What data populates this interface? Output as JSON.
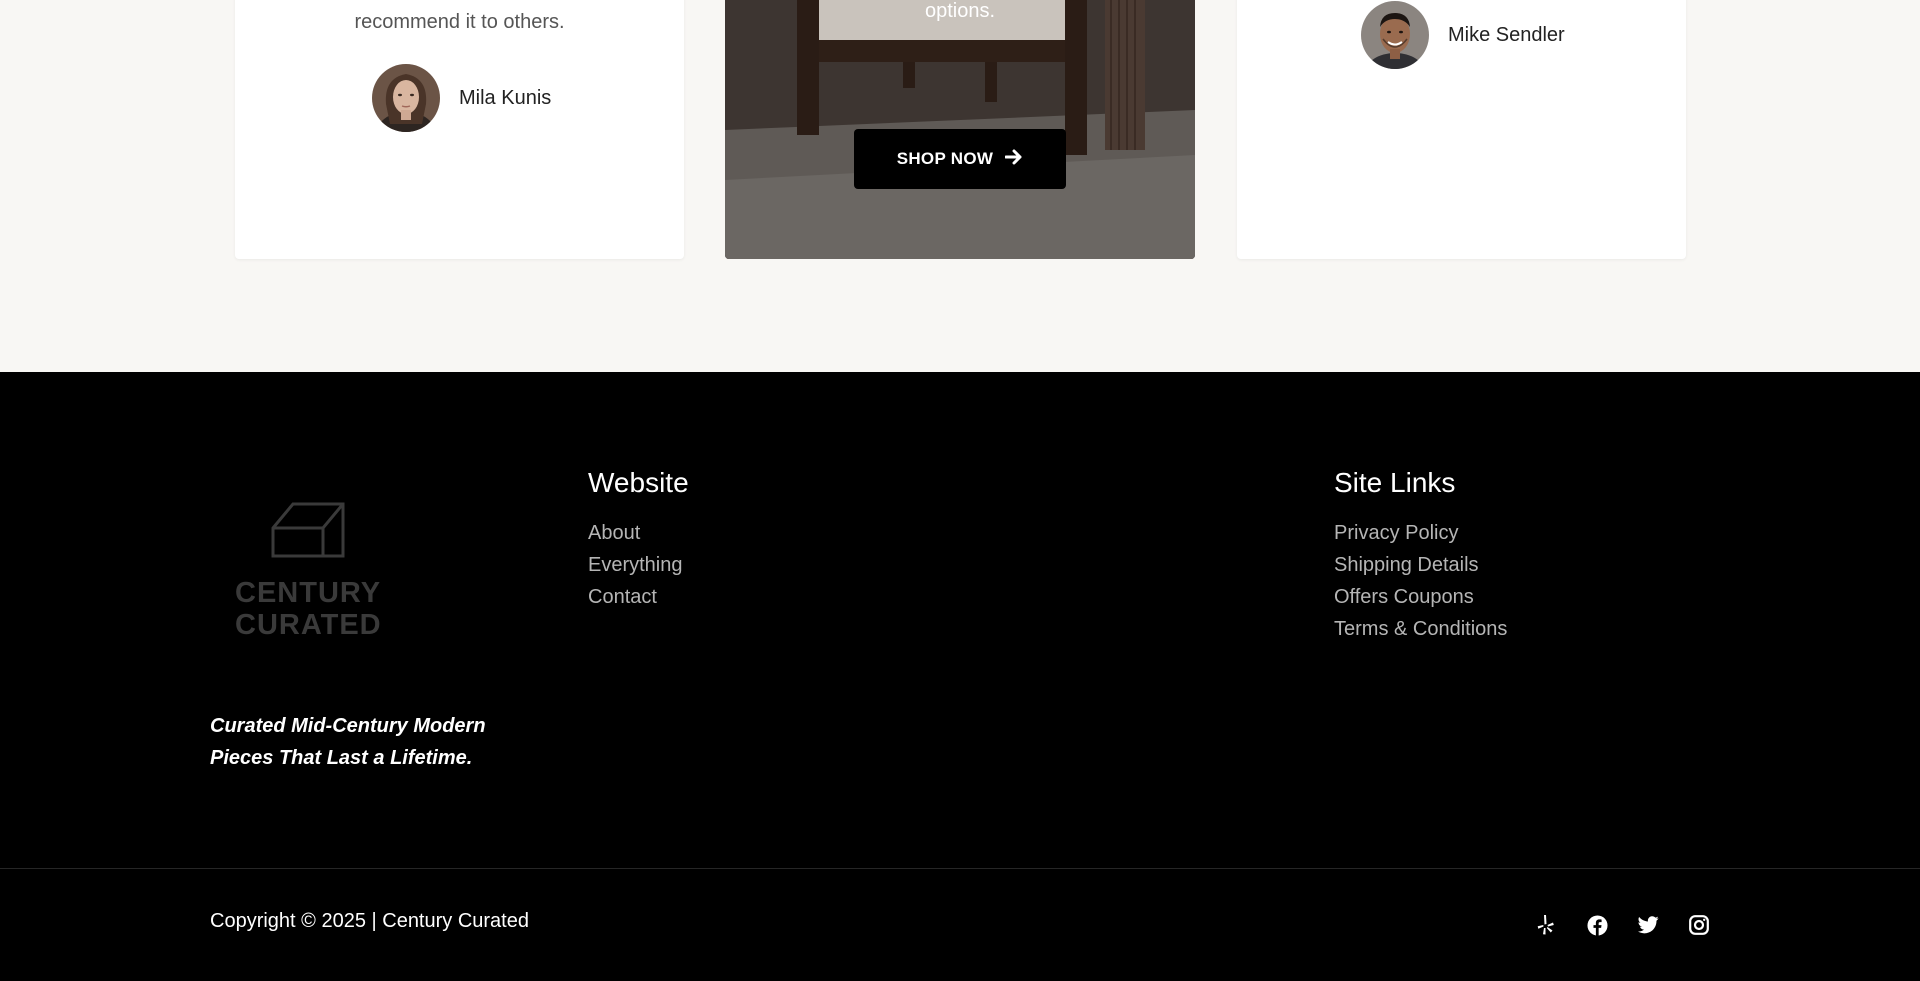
{
  "testimonials": {
    "left": {
      "quote_tail": "recommend it to others.",
      "name": "Mila Kunis"
    },
    "right": {
      "name": "Mike Sendler"
    }
  },
  "promo": {
    "text_tail": "options.",
    "button_label": "SHOP NOW",
    "button_icon": "arrow-right-icon"
  },
  "footer": {
    "logo": {
      "line1": "CENTURY",
      "line2": "CURATED"
    },
    "tagline": "Curated Mid-Century Modern Pieces That Last a Lifetime.",
    "website": {
      "title": "Website",
      "links": [
        "About",
        "Everything",
        "Contact"
      ]
    },
    "site_links": {
      "title": "Site Links",
      "links": [
        "Privacy Policy",
        "Shipping Details",
        "Offers Coupons",
        "Terms & Conditions"
      ]
    },
    "copyright": "Copyright © 2025 | Century Curated",
    "socials": [
      "yelp-icon",
      "facebook-icon",
      "twitter-icon",
      "instagram-icon"
    ]
  },
  "colors": {
    "page_bg": "#f8f7f4",
    "footer_bg": "#000000",
    "link_gray": "#b5b5b5",
    "button_bg": "#000000"
  }
}
